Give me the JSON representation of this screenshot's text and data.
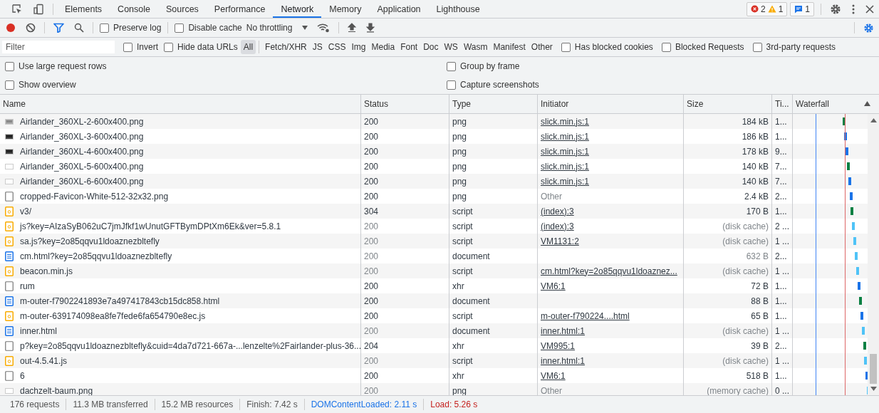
{
  "tabs": [
    {
      "label": "Elements",
      "selected": false
    },
    {
      "label": "Console",
      "selected": false
    },
    {
      "label": "Sources",
      "selected": false
    },
    {
      "label": "Performance",
      "selected": false
    },
    {
      "label": "Network",
      "selected": true
    },
    {
      "label": "Memory",
      "selected": false
    },
    {
      "label": "Application",
      "selected": false
    },
    {
      "label": "Lighthouse",
      "selected": false
    }
  ],
  "issues": {
    "errors": "2",
    "warnings": "1",
    "messages": "1"
  },
  "toolbar": {
    "recording": true,
    "preserve_log": {
      "label": "Preserve log",
      "checked": false
    },
    "disable_cache": {
      "label": "Disable cache",
      "checked": false
    },
    "throttling": "No throttling"
  },
  "filter": {
    "placeholder": "Filter",
    "invert": {
      "label": "Invert",
      "checked": false
    },
    "hide_data_urls": {
      "label": "Hide data URLs",
      "checked": false
    },
    "types": [
      {
        "label": "All",
        "selected": true
      },
      {
        "label": "Fetch/XHR",
        "selected": false
      },
      {
        "label": "JS",
        "selected": false
      },
      {
        "label": "CSS",
        "selected": false
      },
      {
        "label": "Img",
        "selected": false
      },
      {
        "label": "Media",
        "selected": false
      },
      {
        "label": "Font",
        "selected": false
      },
      {
        "label": "Doc",
        "selected": false
      },
      {
        "label": "WS",
        "selected": false
      },
      {
        "label": "Wasm",
        "selected": false
      },
      {
        "label": "Manifest",
        "selected": false
      },
      {
        "label": "Other",
        "selected": false
      }
    ],
    "extra": [
      {
        "label": "Has blocked cookies",
        "checked": false
      },
      {
        "label": "Blocked Requests",
        "checked": false
      },
      {
        "label": "3rd-party requests",
        "checked": false
      }
    ]
  },
  "options": [
    {
      "label": "Use large request rows",
      "checked": false
    },
    {
      "label": "Group by frame",
      "checked": false
    },
    {
      "label": "Show overview",
      "checked": false
    },
    {
      "label": "Capture screenshots",
      "checked": false
    }
  ],
  "columns": [
    "Name",
    "Status",
    "Type",
    "Initiator",
    "Size",
    "Ti...",
    "Waterfall"
  ],
  "rows": [
    {
      "kind": "thumbnail",
      "name": "Airlander_360XL-2-600x400.png",
      "status": "200",
      "type": "png",
      "initiator": "slick.min.js:1",
      "linked": true,
      "size": "184 kB",
      "time": "1...",
      "cached": false
    },
    {
      "kind": "thumbnail",
      "name": "Airlander_360XL-3-600x400.png",
      "status": "200",
      "type": "png",
      "initiator": "slick.min.js:1",
      "linked": true,
      "size": "186 kB",
      "time": "1...",
      "cached": false
    },
    {
      "kind": "thumbnail",
      "name": "Airlander_360XL-4-600x400.png",
      "status": "200",
      "type": "png",
      "initiator": "slick.min.js:1",
      "linked": true,
      "size": "178 kB",
      "time": "9...",
      "cached": false
    },
    {
      "kind": "thumbnail",
      "name": "Airlander_360XL-5-600x400.png",
      "status": "200",
      "type": "png",
      "initiator": "slick.min.js:1",
      "linked": true,
      "size": "140 kB",
      "time": "7...",
      "cached": false
    },
    {
      "kind": "thumbnail",
      "name": "Airlander_360XL-6-600x400.png",
      "status": "200",
      "type": "png",
      "initiator": "slick.min.js:1",
      "linked": true,
      "size": "140 kB",
      "time": "7...",
      "cached": false
    },
    {
      "kind": "file",
      "name": "cropped-Favicon-White-512-32x32.png",
      "status": "200",
      "type": "png",
      "initiator": "Other",
      "linked": false,
      "size": "2.4 kB",
      "time": "2...",
      "cached": false
    },
    {
      "kind": "script",
      "name": "v3/",
      "status": "304",
      "type": "script",
      "initiator": "(index):3",
      "linked": true,
      "size": "170 B",
      "time": "1...",
      "cached": false
    },
    {
      "kind": "script",
      "name": "js?key=AIzaSyB062uC7jmJfkf1wUnutGFTBymDPtXm6Ek&ver=5.8.1",
      "status": "200",
      "type": "script",
      "initiator": "(index):3",
      "linked": true,
      "size": "(disk cache)",
      "time": "2 ...",
      "cached": true
    },
    {
      "kind": "script",
      "name": "sa.js?key=2o85qqvu1ldoaznezbltefly",
      "status": "200",
      "type": "script",
      "initiator": "VM1131:2",
      "linked": true,
      "size": "(disk cache)",
      "time": "1 ...",
      "cached": true
    },
    {
      "kind": "document",
      "name": "cm.html?key=2o85qqvu1ldoaznezbltefly",
      "status": "200",
      "type": "document",
      "size": "632 B",
      "time": "2...",
      "cached": true
    },
    {
      "kind": "script",
      "name": "beacon.min.js",
      "status": "200",
      "type": "script",
      "initiator": "cm.html?key=2o85qqvu1ldoaznez...",
      "linked": true,
      "size": "(disk cache)",
      "time": "1 ...",
      "cached": true
    },
    {
      "kind": "file",
      "name": "rum",
      "status": "200",
      "type": "xhr",
      "initiator": "VM6:1",
      "linked": true,
      "size": "72 B",
      "time": "1...",
      "cached": false
    },
    {
      "kind": "document",
      "name": "m-outer-f7902241893e7a497417843cb15dc858.html",
      "status": "200",
      "type": "document",
      "size": "88 B",
      "time": "1...",
      "cached": false
    },
    {
      "kind": "script",
      "name": "m-outer-639174098ea8fe7fede6fa654790e8ec.js",
      "status": "200",
      "type": "script",
      "initiator": "m-outer-f790224....html",
      "linked": true,
      "size": "65 B",
      "time": "1...",
      "cached": false
    },
    {
      "kind": "document",
      "name": "inner.html",
      "status": "200",
      "type": "document",
      "initiator": "inner.html:1",
      "linked": true,
      "size": "(disk cache)",
      "time": "1 ...",
      "cached": true
    },
    {
      "kind": "file",
      "name": "p?key=2o85qqvu1ldoaznezbltefly&cuid=4da7d721-667a-...lenzelte%2Fairlander-plus-36...",
      "status": "204",
      "type": "xhr",
      "initiator": "VM995:1",
      "linked": true,
      "size": "39 B",
      "time": "2...",
      "cached": false
    },
    {
      "kind": "script",
      "name": "out-4.5.41.js",
      "status": "200",
      "type": "script",
      "initiator": "inner.html:1",
      "linked": true,
      "size": "(disk cache)",
      "time": "1 ...",
      "cached": true
    },
    {
      "kind": "file",
      "name": "6",
      "status": "200",
      "type": "xhr",
      "initiator": "VM6:1",
      "linked": true,
      "size": "518 B",
      "time": "1...",
      "cached": false
    },
    {
      "kind": "thumbnail",
      "name": "dachzelt-baum.png",
      "status": "200",
      "type": "png",
      "initiator": "Other",
      "linked": false,
      "size": "(memory cache)",
      "time": "0 ...",
      "cached": true
    }
  ],
  "summary": [
    {
      "text": "176 requests",
      "kind": "plain"
    },
    {
      "text": "11.3 MB transferred",
      "kind": "plain"
    },
    {
      "text": "15.2 MB resources",
      "kind": "plain"
    },
    {
      "text": "Finish: 7.42 s",
      "kind": "plain"
    },
    {
      "text": "DOMContentLoaded: 2.11 s",
      "kind": "dom"
    },
    {
      "text": "Load: 5.26 s",
      "kind": "load"
    }
  ]
}
